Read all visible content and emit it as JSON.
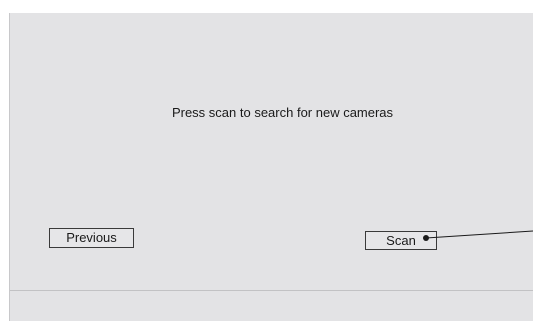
{
  "dialog": {
    "message": "Press scan to search for new cameras",
    "previous_label": "Previous",
    "scan_label": "Scan"
  }
}
